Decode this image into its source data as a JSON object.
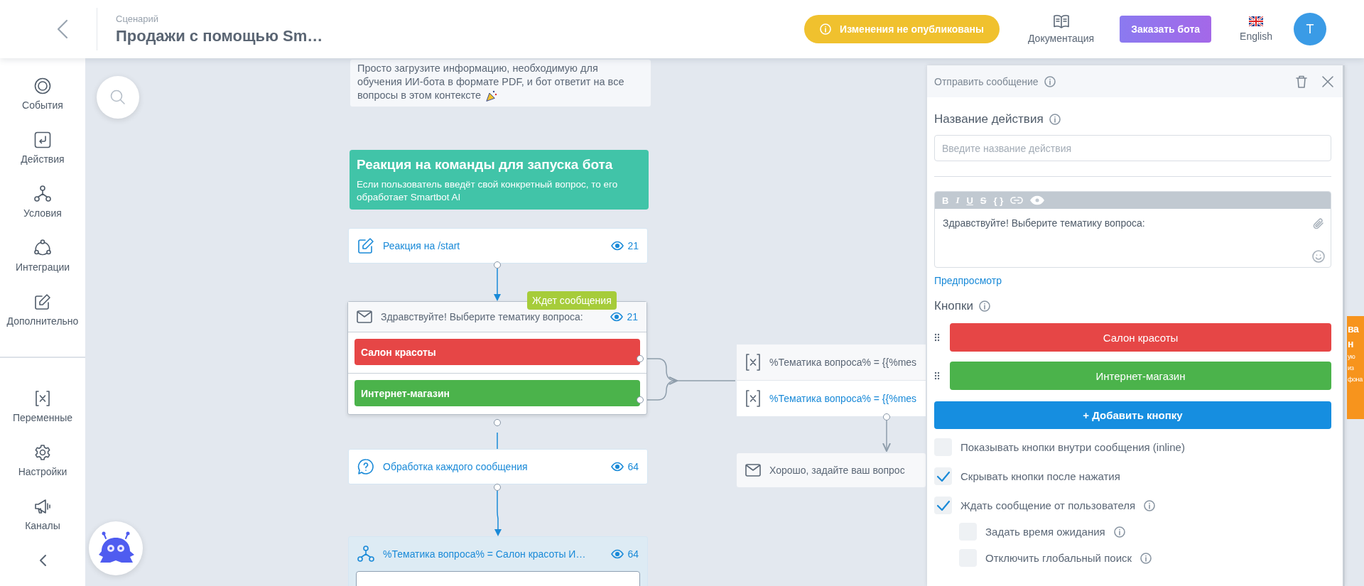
{
  "header": {
    "breadcrumb": "Сценарий",
    "title": "Продажи с помощью Sm…",
    "warning": "Изменения не опубликованы",
    "docs": "Документация",
    "order_button": "Заказать бота",
    "language": "English",
    "avatar": "Т"
  },
  "sidebar": {
    "items": [
      {
        "label": "События"
      },
      {
        "label": "Действия"
      },
      {
        "label": "Условия"
      },
      {
        "label": "Интеграции"
      },
      {
        "label": "Дополнительно"
      }
    ],
    "tools": [
      {
        "label": "Переменные"
      },
      {
        "label": "Настройки"
      },
      {
        "label": "Каналы"
      }
    ]
  },
  "canvas": {
    "nodes": [
      {
        "kind": "note",
        "lines": [
          "Просто загрузите информацию, необходимую для",
          "обучения ИИ-бота в формате PDF, и бот ответит на все",
          "вопросы в этом контексте"
        ]
      },
      {
        "kind": "group",
        "title": "Реакция на команды для запуска бота",
        "text": "Если пользователь введёт свой конкретный вопрос, то его обработает Smartbot AI"
      },
      {
        "kind": "trigger",
        "label": "Реакция на /start",
        "views": "21"
      },
      {
        "kind": "message",
        "label": "Здравствуйте! Выберите тематику вопроса:",
        "views": "21",
        "badge": "Ждет сообщения",
        "buttons": [
          {
            "label": "Салон красоты",
            "color": "#e64646"
          },
          {
            "label": "Интернет-магазин",
            "color": "#4bb34b"
          }
        ]
      },
      {
        "kind": "handler",
        "label": "Обработка каждого сообщения",
        "views": "64"
      },
      {
        "kind": "condition",
        "label": "%Тематика вопроса% = Салон красоты И…",
        "views": "64"
      },
      {
        "kind": "variables",
        "rows": [
          {
            "text": "%Тематика вопроса% = {{%mes",
            "highlighted": false
          },
          {
            "text": "%Тематика вопроса% = {{%mes",
            "highlighted": true
          }
        ]
      },
      {
        "kind": "reply",
        "label": "Хорошо, задайте ваш вопрос"
      }
    ]
  },
  "panel": {
    "title": "Отправить сообщение",
    "name_label": "Название действия",
    "name_placeholder": "Введите название действия",
    "format_tools": [
      "B",
      "I",
      "U",
      "S",
      "{ }"
    ],
    "message": "Здравствуйте! Выберите тематику вопроса:",
    "preview": "Предпросмотр",
    "buttons_label": "Кнопки",
    "buttons": [
      {
        "label": "Салон красоты",
        "color": "#e64646"
      },
      {
        "label": "Интернет-магазин",
        "color": "#4bb34b"
      }
    ],
    "add_button": "+ Добавить кнопку",
    "options": [
      {
        "label": "Показывать кнопки внутри сообщения (inline)",
        "checked": false,
        "info": false
      },
      {
        "label": "Скрывать кнопки после нажатия",
        "checked": true,
        "info": false
      },
      {
        "label": "Ждать сообщение от пользователя",
        "checked": true,
        "info": true,
        "children": [
          {
            "label": "Задать время ожидания",
            "checked": false,
            "info": true
          },
          {
            "label": "Отключить глобальный поиск",
            "checked": false,
            "info": true
          }
        ]
      }
    ]
  },
  "promo": {
    "lines": [
      "ва",
      "н",
      "ую",
      "из",
      "фона"
    ]
  }
}
